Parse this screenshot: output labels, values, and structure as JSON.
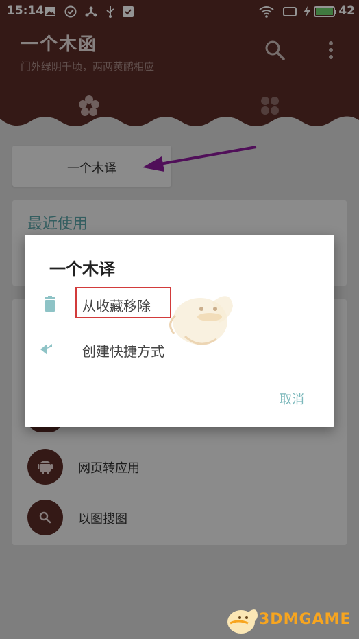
{
  "status_bar": {
    "time": "15:14",
    "battery": "42"
  },
  "app": {
    "title": "一个木函",
    "subtitle": "门外绿阴千顷，两两黄鹂相应"
  },
  "icons": {
    "search": "search-icon",
    "more": "more-vert-icon",
    "tab_flower": "flower-icon",
    "tab_grid": "grid-icon",
    "delete": "trash-icon",
    "shortcut": "reply-all-icon",
    "android": "android-icon",
    "image_search": "search-icon"
  },
  "favorites": {
    "item_label": "一个木译"
  },
  "recent": {
    "heading": "最近使用"
  },
  "tools": {
    "items": [
      {
        "label": "网页转应用"
      },
      {
        "label": "以图搜图"
      }
    ]
  },
  "dialog": {
    "title": "一个木译",
    "options": [
      {
        "label": "从收藏移除"
      },
      {
        "label": "创建快捷方式"
      }
    ],
    "cancel_label": "取消"
  },
  "watermark": {
    "text": "3DMGAME"
  },
  "colors": {
    "primary": "#5a2b27",
    "accent": "#5aa3a6",
    "cancel": "#7cb8bb",
    "annotation_arrow": "#8a1a9a",
    "highlight": "#d23b3b"
  }
}
